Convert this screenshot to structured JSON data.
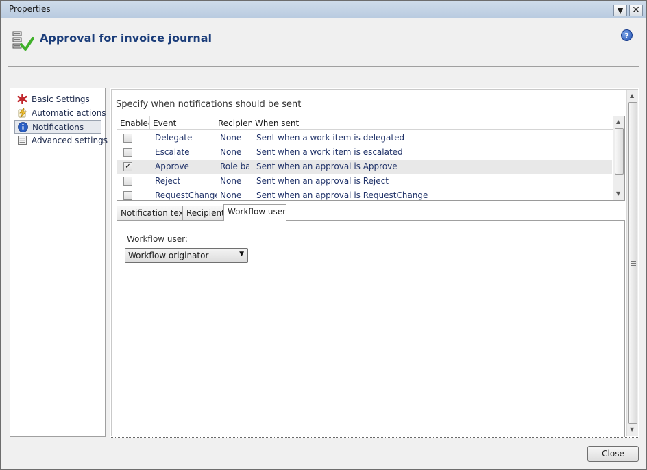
{
  "window": {
    "title": "Properties",
    "dropdown_icon": "▼",
    "close_icon": "✕"
  },
  "header": {
    "title": "Approval for invoice journal",
    "icon": "workflow-approval-icon",
    "help_icon": "?"
  },
  "sidebar": {
    "items": [
      {
        "label": "Basic Settings",
        "icon": "asterisk-icon",
        "selected": false
      },
      {
        "label": "Automatic actions",
        "icon": "lightning-icon",
        "selected": false
      },
      {
        "label": "Notifications",
        "icon": "info-icon",
        "selected": true
      },
      {
        "label": "Advanced settings",
        "icon": "settings-sheet-icon",
        "selected": false
      }
    ]
  },
  "notifications": {
    "label": "Specify when notifications should be sent",
    "columns": [
      "Enabled",
      "Event",
      "Recipient",
      "When sent"
    ],
    "rows": [
      {
        "enabled": false,
        "event": "Delegate",
        "recipient": "None",
        "when_sent": "Sent when a work item is delegated"
      },
      {
        "enabled": false,
        "event": "Escalate",
        "recipient": "None",
        "when_sent": "Sent when a work item is escalated"
      },
      {
        "enabled": true,
        "event": "Approve",
        "recipient": "Role ba:",
        "when_sent": "Sent when an approval is Approve"
      },
      {
        "enabled": false,
        "event": "Reject",
        "recipient": "None",
        "when_sent": "Sent when an approval is Reject"
      },
      {
        "enabled": false,
        "event": "RequestChange",
        "recipient": "None",
        "when_sent": "Sent when an approval is RequestChange"
      }
    ]
  },
  "tabs": [
    {
      "label": "Notification text",
      "active": false
    },
    {
      "label": "Recipient",
      "active": false
    },
    {
      "label": "Workflow user",
      "active": true
    }
  ],
  "workflow_user": {
    "label": "Workflow user:",
    "selected": "Workflow originator"
  },
  "footer": {
    "close_label": "Close"
  },
  "colors": {
    "title_blue": "#1b3d7a",
    "link_text": "#22346a",
    "selected_row": "#e8e8e8"
  }
}
